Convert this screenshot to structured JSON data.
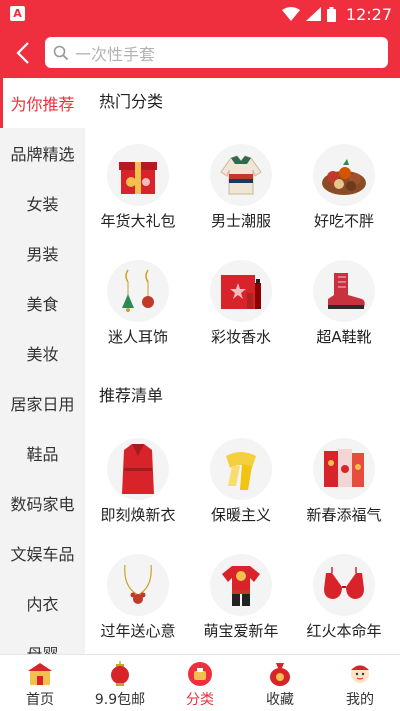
{
  "status_bar": {
    "time": "12:27",
    "notification_icon": "A"
  },
  "search": {
    "placeholder": "一次性手套"
  },
  "sidebar": {
    "items": [
      {
        "label": "为你推荐",
        "active": true
      },
      {
        "label": "品牌精选"
      },
      {
        "label": "女装"
      },
      {
        "label": "男装"
      },
      {
        "label": "美食"
      },
      {
        "label": "美妆"
      },
      {
        "label": "居家日用"
      },
      {
        "label": "鞋品"
      },
      {
        "label": "数码家电"
      },
      {
        "label": "文娱车品"
      },
      {
        "label": "内衣"
      },
      {
        "label": "母婴"
      }
    ]
  },
  "sections": {
    "hot": {
      "title": "热门分类",
      "items": [
        {
          "label": "年货大礼包",
          "icon": "gift-box-icon"
        },
        {
          "label": "男士潮服",
          "icon": "jacket-icon"
        },
        {
          "label": "好吃不胖",
          "icon": "snacks-icon"
        },
        {
          "label": "迷人耳饰",
          "icon": "earrings-icon"
        },
        {
          "label": "彩妆香水",
          "icon": "perfume-icon"
        },
        {
          "label": "超A鞋靴",
          "icon": "boot-icon"
        }
      ]
    },
    "recommend": {
      "title": "推荐清单",
      "items": [
        {
          "label": "即刻焕新衣",
          "icon": "red-coat-icon"
        },
        {
          "label": "保暖主义",
          "icon": "scarf-icon"
        },
        {
          "label": "新春添福气",
          "icon": "red-envelope-icon"
        },
        {
          "label": "过年送心意",
          "icon": "necklace-icon"
        },
        {
          "label": "萌宝爱新年",
          "icon": "baby-outfit-icon"
        },
        {
          "label": "红火本命年",
          "icon": "red-bra-icon"
        }
      ]
    }
  },
  "tabbar": {
    "items": [
      {
        "label": "首页",
        "icon": "home-shop-icon"
      },
      {
        "label": "9.9包邮",
        "icon": "lantern-icon"
      },
      {
        "label": "分类",
        "icon": "category-icon",
        "active": true
      },
      {
        "label": "收藏",
        "icon": "money-bag-icon"
      },
      {
        "label": "我的",
        "icon": "profile-icon"
      }
    ]
  },
  "colors": {
    "accent": "#ef2f3e",
    "sidebar_bg": "#f3f3f3",
    "text": "#222222"
  }
}
